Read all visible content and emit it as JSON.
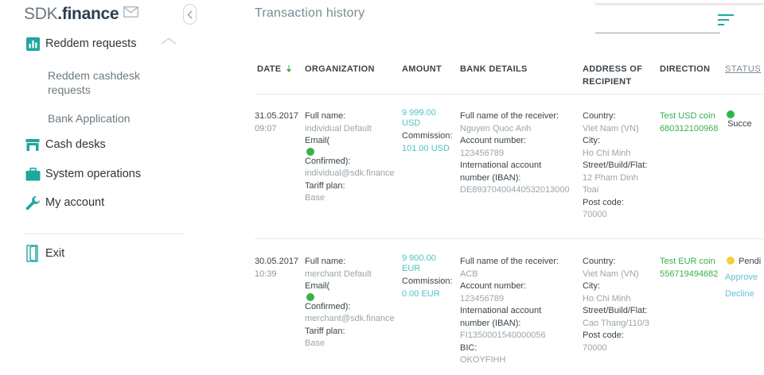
{
  "sidebar": {
    "logo_main": "SDK",
    "logo_suffix": ".finance",
    "items": [
      {
        "label": "Reddem requests",
        "icon": "bar-chart-icon"
      },
      {
        "label": "Reddem cashdesk requests"
      },
      {
        "label": "Bank Application"
      },
      {
        "label": "Cash desks",
        "icon": "store-icon"
      },
      {
        "label": "System operations",
        "icon": "briefcase-icon"
      },
      {
        "label": "My account",
        "icon": "wrench-icon"
      }
    ],
    "exit_label": "Exit"
  },
  "header": {
    "title": "Transaction history"
  },
  "table": {
    "columns": [
      "DATE",
      "ORGANIZATION",
      "AMOUNT",
      "BANK DETAILS",
      "ADDRESS OF",
      "RECIPIENT",
      "DIRECTION",
      "STATUS"
    ],
    "rows": [
      {
        "date": "31.05.2017",
        "time": "09:07",
        "org_fullname_label": "Full name:",
        "org_fullname": "individual Default",
        "org_email_label": "Email(",
        "org_confirmed": "Confirmed):",
        "org_email": "individual@sdk.finance",
        "org_tariff_label": "Tariff plan:",
        "org_tariff": "Base",
        "amount": "9 999.00",
        "currency": "USD",
        "commission_label": "Commission:",
        "commission": "101.00 USD",
        "bank_receiver_label": "Full name of the receiver:",
        "bank_receiver": "Nguyen Quoc Anh",
        "bank_account_label": "Account number:",
        "bank_account": "123456789",
        "bank_iban_label1": "International account",
        "bank_iban_label2": "number (IBAN):",
        "bank_iban": "DE89370400440532013000",
        "country_label": "Country:",
        "country": "Viet Nam (VN)",
        "city_label": "City:",
        "city": "Ho Chi Minh",
        "street_label": "Street/Build/Flat:",
        "street1": "12 Pham Dinh",
        "street2": "Toai",
        "post_label": "Post code:",
        "post": "70000",
        "direction_name": "Test USD coin",
        "direction_id": "680312100968",
        "status": "Succe"
      },
      {
        "date": "30.05.2017",
        "time": "10:39",
        "org_fullname_label": "Full name:",
        "org_fullname": "merchant Default",
        "org_email_label": "Email(",
        "org_confirmed": "Confirmed):",
        "org_email": "merchant@sdk.finance",
        "org_tariff_label": "Tariff plan:",
        "org_tariff": "Base",
        "amount": "9 900.00",
        "currency": "EUR",
        "commission_label": "Commission:",
        "commission": "0.00 EUR",
        "bank_receiver_label": "Full name of the receiver:",
        "bank_receiver": "ACB",
        "bank_account_label": "Account number:",
        "bank_account": "123456789",
        "bank_iban_label1": "International account",
        "bank_iban_label2": "number (IBAN):",
        "bank_iban": "FI1350001540000056",
        "bic_label": "BIC:",
        "bic": "OKOYFIHH",
        "country_label": "Country:",
        "country": "Viet Nam (VN)",
        "city_label": "City:",
        "city": "Ho Chi Minh",
        "street_label": "Street/Build/Flat:",
        "street1": "Cao Thang/110/3",
        "post_label": "Post code:",
        "post": "70000",
        "direction_name": "Test EUR coin",
        "direction_id": "556719494682",
        "status": "Pendi",
        "approve": "Approve",
        "decline": "Decline"
      }
    ]
  },
  "colors": {
    "teal": "#4ec3c9",
    "green": "#36b24a",
    "brand": "#2c3e50",
    "accent_icon": "#1fa89d",
    "pending": "#f3d03e"
  }
}
